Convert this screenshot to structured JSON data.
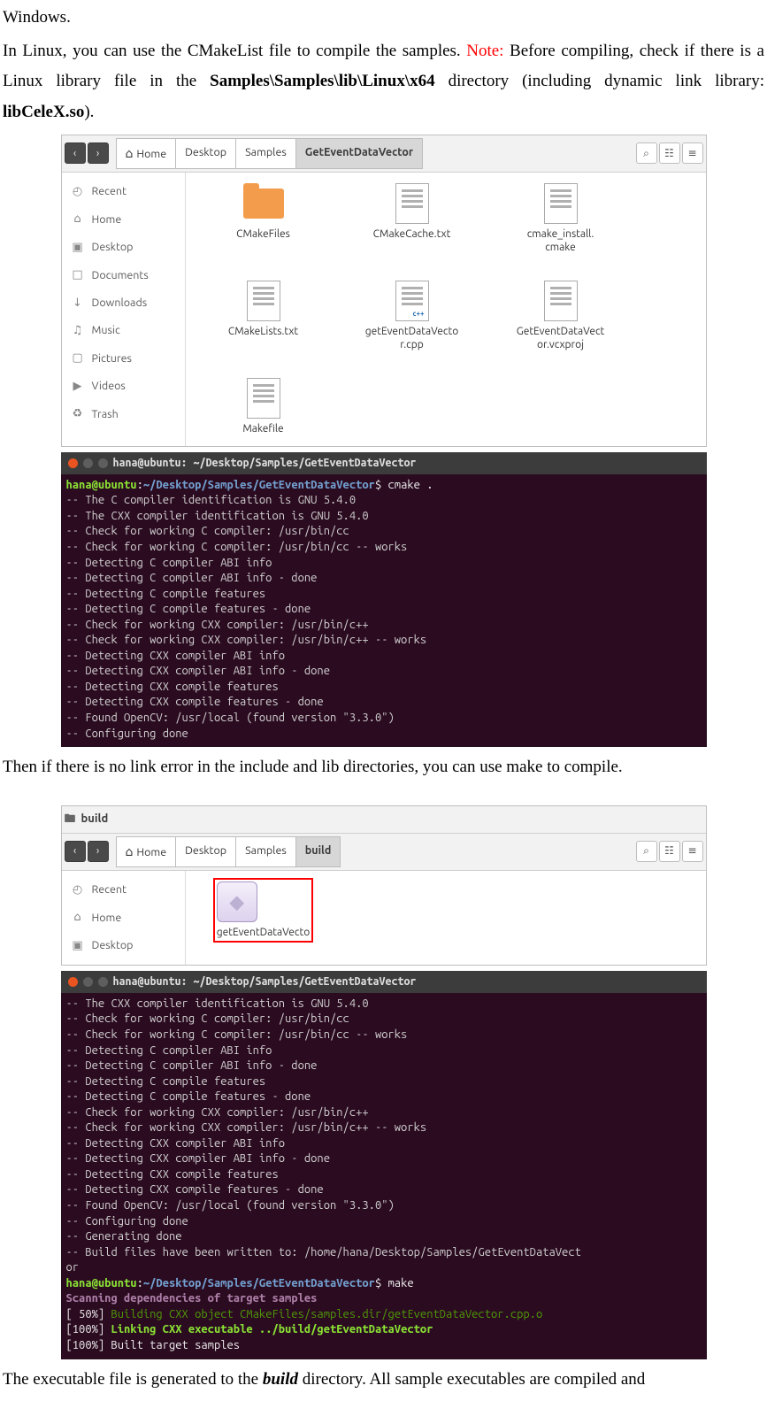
{
  "text": {
    "p0": "Windows.",
    "p1_a": "In Linux, you can use the CMakeList file to compile the samples. ",
    "p1_note": "Note:",
    "p1_b": " Before compiling, check if there is a Linux library file in the ",
    "p1_bold1": "Samples\\Samples\\lib\\Linux\\x64",
    "p1_c": " directory (including dynamic link library: ",
    "p1_bold2": "libCeleX.so",
    "p1_d": ").",
    "p2": "Then if there is no link error in the include and lib directories, you can use make to compile.",
    "p3_a": "The executable file is generated to the ",
    "p3_bi": "build",
    "p3_b": " directory. All sample executables are compiled and"
  },
  "fm1": {
    "crumbs": [
      "Home",
      "Desktop",
      "Samples",
      "GetEventDataVector"
    ],
    "sidebar": [
      {
        "icon": "◴",
        "label": "Recent"
      },
      {
        "icon": "⌂",
        "label": "Home"
      },
      {
        "icon": "▣",
        "label": "Desktop"
      },
      {
        "icon": "□",
        "label": "Documents"
      },
      {
        "icon": "↓",
        "label": "Downloads"
      },
      {
        "icon": "♫",
        "label": "Music"
      },
      {
        "icon": "▢",
        "label": "Pictures"
      },
      {
        "icon": "▶",
        "label": "Videos"
      },
      {
        "icon": "♻",
        "label": "Trash"
      }
    ],
    "files": [
      {
        "type": "folder",
        "label": "CMakeFiles"
      },
      {
        "type": "file",
        "label": "CMakeCache.txt"
      },
      {
        "type": "file",
        "label": "cmake_install.\ncmake"
      },
      {
        "type": "file",
        "label": "CMakeLists.txt"
      },
      {
        "type": "cpp",
        "label": "getEventDataVecto\nr.cpp"
      },
      {
        "type": "file",
        "label": "GetEventDataVect\nor.vcxproj"
      },
      {
        "type": "file",
        "label": "Makefile"
      }
    ]
  },
  "term1": {
    "title": "hana@ubuntu: ~/Desktop/Samples/GetEventDataVector",
    "prompt_user": "hana@ubuntu",
    "prompt_path": "~/Desktop/Samples/GetEventDataVector",
    "cmd": "cmake .",
    "lines": [
      "-- The C compiler identification is GNU 5.4.0",
      "-- The CXX compiler identification is GNU 5.4.0",
      "-- Check for working C compiler: /usr/bin/cc",
      "-- Check for working C compiler: /usr/bin/cc -- works",
      "-- Detecting C compiler ABI info",
      "-- Detecting C compiler ABI info - done",
      "-- Detecting C compile features",
      "-- Detecting C compile features - done",
      "-- Check for working CXX compiler: /usr/bin/c++",
      "-- Check for working CXX compiler: /usr/bin/c++ -- works",
      "-- Detecting CXX compiler ABI info",
      "-- Detecting CXX compiler ABI info - done",
      "-- Detecting CXX compile features",
      "-- Detecting CXX compile features - done",
      "-- Found OpenCV: /usr/local (found version \"3.3.0\")",
      "-- Configuring done"
    ]
  },
  "fm2": {
    "title": "build",
    "crumbs": [
      "Home",
      "Desktop",
      "Samples",
      "build"
    ],
    "sidebar": [
      {
        "icon": "◴",
        "label": "Recent"
      },
      {
        "icon": "⌂",
        "label": "Home"
      },
      {
        "icon": "▣",
        "label": "Desktop"
      }
    ],
    "files": [
      {
        "type": "exec",
        "label": "getEventDataVecto",
        "hl": true
      }
    ]
  },
  "term2": {
    "title": "hana@ubuntu: ~/Desktop/Samples/GetEventDataVector",
    "lines": [
      "-- The CXX compiler identification is GNU 5.4.0",
      "-- Check for working C compiler: /usr/bin/cc",
      "-- Check for working C compiler: /usr/bin/cc -- works",
      "-- Detecting C compiler ABI info",
      "-- Detecting C compiler ABI info - done",
      "-- Detecting C compile features",
      "-- Detecting C compile features - done",
      "-- Check for working CXX compiler: /usr/bin/c++",
      "-- Check for working CXX compiler: /usr/bin/c++ -- works",
      "-- Detecting CXX compiler ABI info",
      "-- Detecting CXX compiler ABI info - done",
      "-- Detecting CXX compile features",
      "-- Detecting CXX compile features - done",
      "-- Found OpenCV: /usr/local (found version \"3.3.0\")",
      "-- Configuring done",
      "-- Generating done",
      "-- Build files have been written to: /home/hana/Desktop/Samples/GetEventDataVect",
      "or"
    ],
    "prompt_user": "hana@ubuntu",
    "prompt_path": "~/Desktop/Samples/GetEventDataVector",
    "cmd": "make",
    "scan": "Scanning dependencies of target samples",
    "pct50": "[ 50%]",
    "build50": " Building CXX object CMakeFiles/samples.dir/getEventDataVector.cpp.o",
    "pct100a": "[100%]",
    "link100": " Linking CXX executable ../build/getEventDataVector",
    "pct100b": "[100%]",
    "built": " Built target samples"
  }
}
